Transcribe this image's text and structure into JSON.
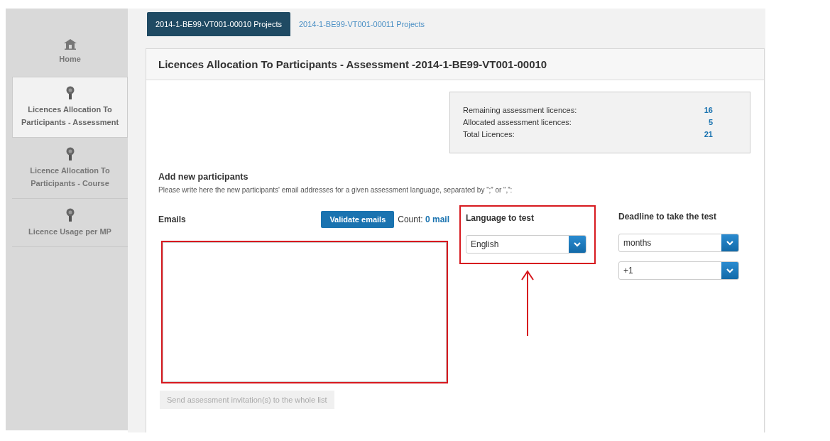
{
  "tabs": [
    {
      "label": "2014-1-BE99-VT001-00010 Projects",
      "selected": true
    },
    {
      "label": "2014-1-BE99-VT001-00011 Projects",
      "selected": false
    }
  ],
  "sidebar": {
    "items": [
      {
        "kind": "home",
        "label": "Home",
        "selected": false
      },
      {
        "kind": "award",
        "label": "Licences Allocation To Participants - Assessment",
        "selected": true
      },
      {
        "kind": "award",
        "label": "Licence Allocation To Participants - Course",
        "selected": false
      },
      {
        "kind": "award",
        "label": "Licence Usage per MP",
        "selected": false
      }
    ]
  },
  "panel": {
    "title": "Licences Allocation To Participants - Assessment -2014-1-BE99-VT001-00010",
    "stats": [
      {
        "label": "Remaining assessment licences:",
        "value": "16"
      },
      {
        "label": "Allocated assessment licences:",
        "value": "5"
      },
      {
        "label": "Total Licences:",
        "value": "21"
      }
    ],
    "heading": "Add new participants",
    "description": "Please write here the new participants' email addresses for a given assessment language, separated by “;” or “,”:",
    "emails": {
      "label": "Emails",
      "validate_button": "Validate emails",
      "count": "Count: **0 mail**",
      "highlighted": true,
      "send_button": {
        "label": "Send assessment invitation(s) to the whole list",
        "disabled": true
      }
    },
    "language": {
      "label": "Language to test",
      "value": "English",
      "highlighted": true,
      "pointer_arrow": true
    },
    "deadline": {
      "label": "Deadline to take the test",
      "unit": "months",
      "offset": "+1"
    }
  }
}
